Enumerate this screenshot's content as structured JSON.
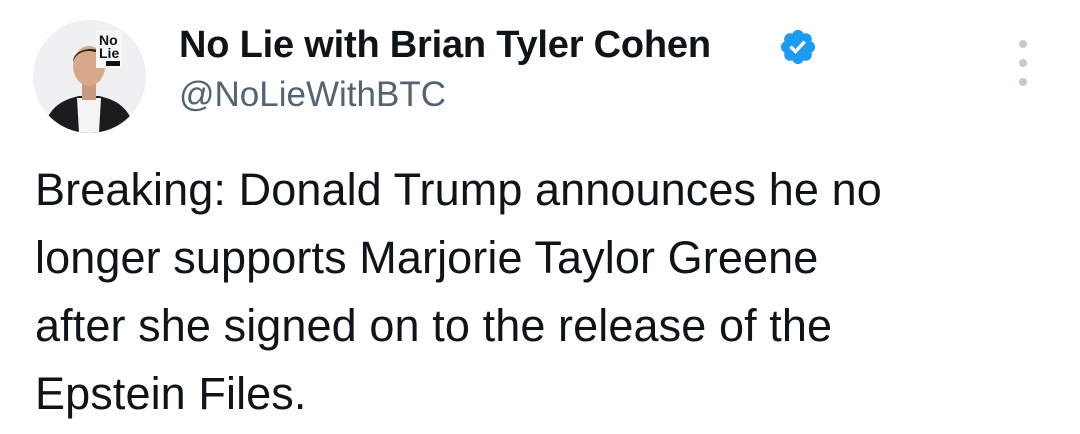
{
  "author": {
    "display_name": "No Lie with Brian Tyler Cohen",
    "handle": "@NoLieWithBTC",
    "verified_icon": "verified-badge-icon",
    "verified_color": "#1d9bf0",
    "avatar_logo_text": [
      "No",
      "Lie"
    ]
  },
  "menu": {
    "icon": "more-options-icon"
  },
  "tweet": {
    "lines": [
      "Breaking: Donald Trump announces he no",
      "longer supports Marjorie Taylor Greene",
      "after she signed on to the release of the",
      "Epstein Files."
    ]
  }
}
